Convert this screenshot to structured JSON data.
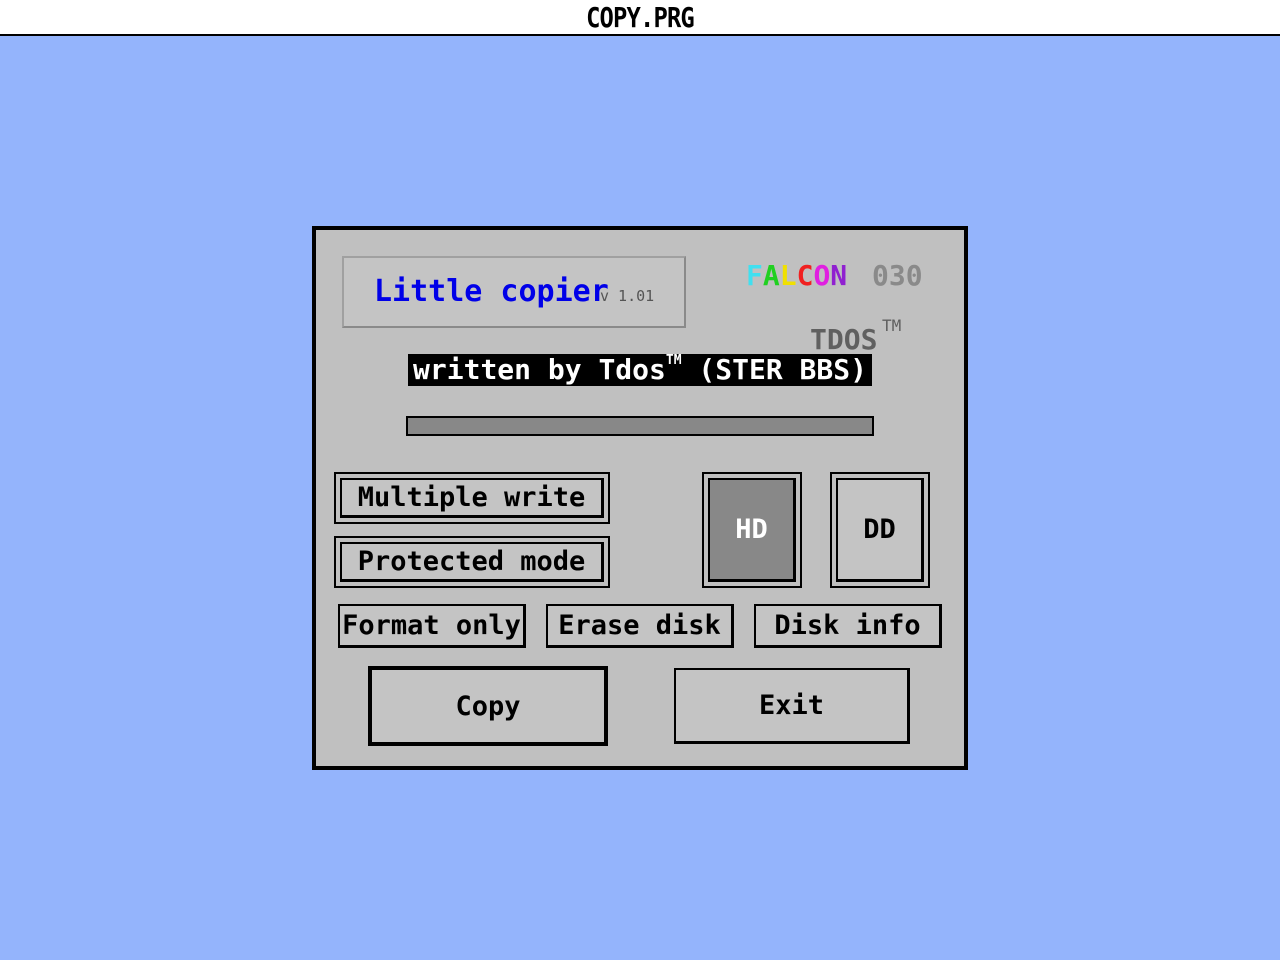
{
  "menubar": {
    "title": "COPY.PRG"
  },
  "dialog": {
    "title": "Little copier",
    "version": "v 1.01",
    "platform_logo": {
      "letters": [
        {
          "char": "F",
          "color": "#40e0f0"
        },
        {
          "char": "A",
          "color": "#20d020"
        },
        {
          "char": "L",
          "color": "#f0e000"
        },
        {
          "char": "C",
          "color": "#f02020"
        },
        {
          "char": "O",
          "color": "#e020e0"
        },
        {
          "char": "N",
          "color": "#9020d0"
        }
      ],
      "model": "030",
      "model_color": "#8a8a8a"
    },
    "brand_logo": "TDOS",
    "brand_tm": "TM",
    "credit": {
      "prefix": "written by Tdos",
      "tm": "TM",
      "suffix": " (STER BBS)"
    },
    "progress": 0,
    "options": {
      "multiple_write": "Multiple write",
      "protected_mode": "Protected mode"
    },
    "density": {
      "hd": "HD",
      "dd": "DD",
      "selected": "HD"
    },
    "actions": {
      "format_only": "Format only",
      "erase_disk": "Erase disk",
      "disk_info": "Disk info"
    },
    "copy_label": "Copy",
    "exit_label": "Exit"
  }
}
